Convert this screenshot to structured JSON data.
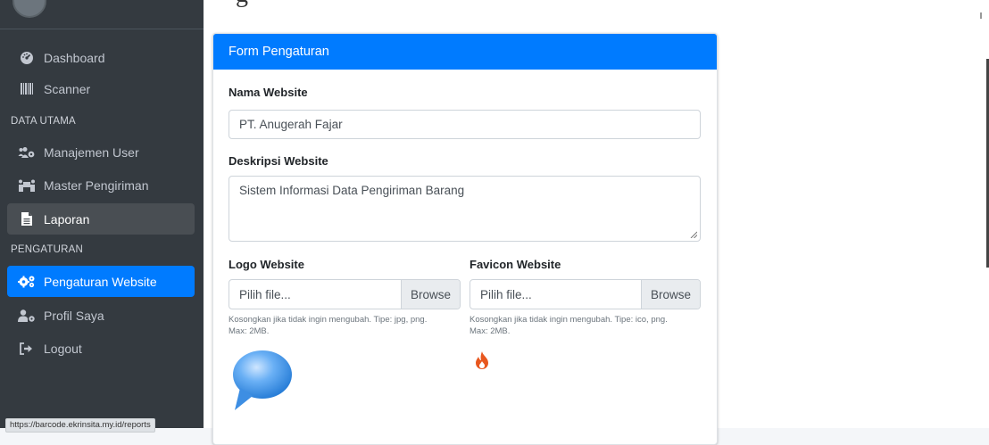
{
  "sidebar": {
    "items": [
      {
        "label": "Dashboard",
        "icon": "tachometer-icon"
      },
      {
        "label": "Scanner",
        "icon": "barcode-icon"
      },
      {
        "label": "Manajemen User",
        "icon": "users-cog-icon"
      },
      {
        "label": "Master Pengiriman",
        "icon": "people-carry-icon"
      },
      {
        "label": "Laporan",
        "icon": "file-icon"
      },
      {
        "label": "Pengaturan Website",
        "icon": "cogs-icon"
      },
      {
        "label": "Profil Saya",
        "icon": "user-cog-icon"
      },
      {
        "label": "Logout",
        "icon": "sign-out-icon"
      }
    ],
    "headers": {
      "data_utama": "DATA UTAMA",
      "pengaturan": "PENGATURAN"
    },
    "active_item": "Pengaturan Website",
    "hovered_item": "Laporan"
  },
  "status_bar": {
    "url": "https://barcode.ekrinsita.my.id/reports"
  },
  "page": {
    "title_fragment": "g"
  },
  "form": {
    "header": "Form Pengaturan",
    "nama_label": "Nama Website",
    "nama_value": "PT. Anugerah Fajar",
    "deskripsi_label": "Deskripsi Website",
    "deskripsi_value": "Sistem Informasi Data Pengiriman Barang",
    "logo_label": "Logo Website",
    "logo_placeholder": "Pilih file...",
    "logo_browse": "Browse",
    "logo_help_1": "Kosongkan jika tidak ingin mengubah. Tipe: jpg, png.",
    "logo_help_2": "Max: 2MB.",
    "favicon_label": "Favicon Website",
    "favicon_placeholder": "Pilih file...",
    "favicon_browse": "Browse",
    "favicon_help_1": "Kosongkan jika tidak ingin mengubah. Tipe: ico, png.",
    "favicon_help_2": "Max: 2MB."
  },
  "colors": {
    "sidebar_bg": "#343a40",
    "accent": "#007bff",
    "favicon_orange": "#e8571e"
  }
}
